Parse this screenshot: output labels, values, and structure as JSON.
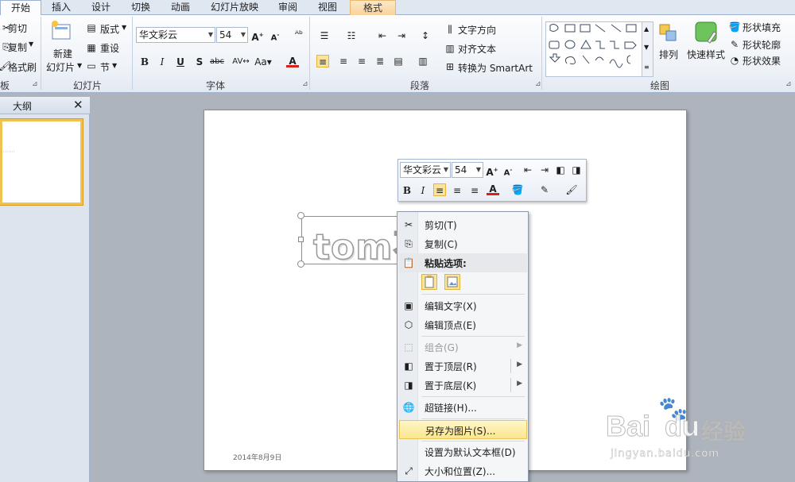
{
  "tabs": [
    "开始",
    "插入",
    "设计",
    "切换",
    "动画",
    "幻灯片放映",
    "审阅",
    "视图",
    "格式"
  ],
  "ribbon": {
    "clipboard": {
      "cut": "剪切",
      "copy": "复制",
      "format_painter": "格式刷",
      "label": "板"
    },
    "slides": {
      "new_slide_line1": "新建",
      "new_slide_line2": "幻灯片",
      "layout": "版式",
      "reset": "重设",
      "section": "节",
      "label": "幻灯片"
    },
    "font": {
      "name": "华文彩云",
      "size": "54",
      "label": "字体"
    },
    "paragraph": {
      "text_direction": "文字方向",
      "align_text": "对齐文本",
      "smartart": "转换为 SmartArt",
      "label": "段落"
    },
    "drawing": {
      "arrange": "排列",
      "quick_styles": "快速样式",
      "shape_fill": "形状填充",
      "shape_outline": "形状轮廓",
      "shape_effects": "形状效果",
      "label": "绘图"
    }
  },
  "left_pane": {
    "outline_tab": "大纲"
  },
  "slide": {
    "text": "tom不",
    "date": "2014年8月9日"
  },
  "mini_toolbar": {
    "font": "华文彩云",
    "size": "54"
  },
  "context_menu": {
    "cut": "剪切(T)",
    "copy": "复制(C)",
    "paste_options": "粘贴选项:",
    "edit_text": "编辑文字(X)",
    "edit_points": "编辑顶点(E)",
    "group": "组合(G)",
    "bring_front": "置于顶层(R)",
    "send_back": "置于底层(K)",
    "hyperlink": "超链接(H)...",
    "save_as_picture": "另存为图片(S)...",
    "set_default_textbox": "设置为默认文本框(D)",
    "size_position": "大小和位置(Z)..."
  },
  "watermark": {
    "brand": "Bai",
    "brand2": "du",
    "cn": "经验",
    "url": "jingyan.baidu.com"
  },
  "colors": {
    "highlight": "#fbe58d",
    "accent_orange": "#f0c24f",
    "ribbon_border": "#9fb3cd",
    "font_color_red": "#d6201c"
  }
}
